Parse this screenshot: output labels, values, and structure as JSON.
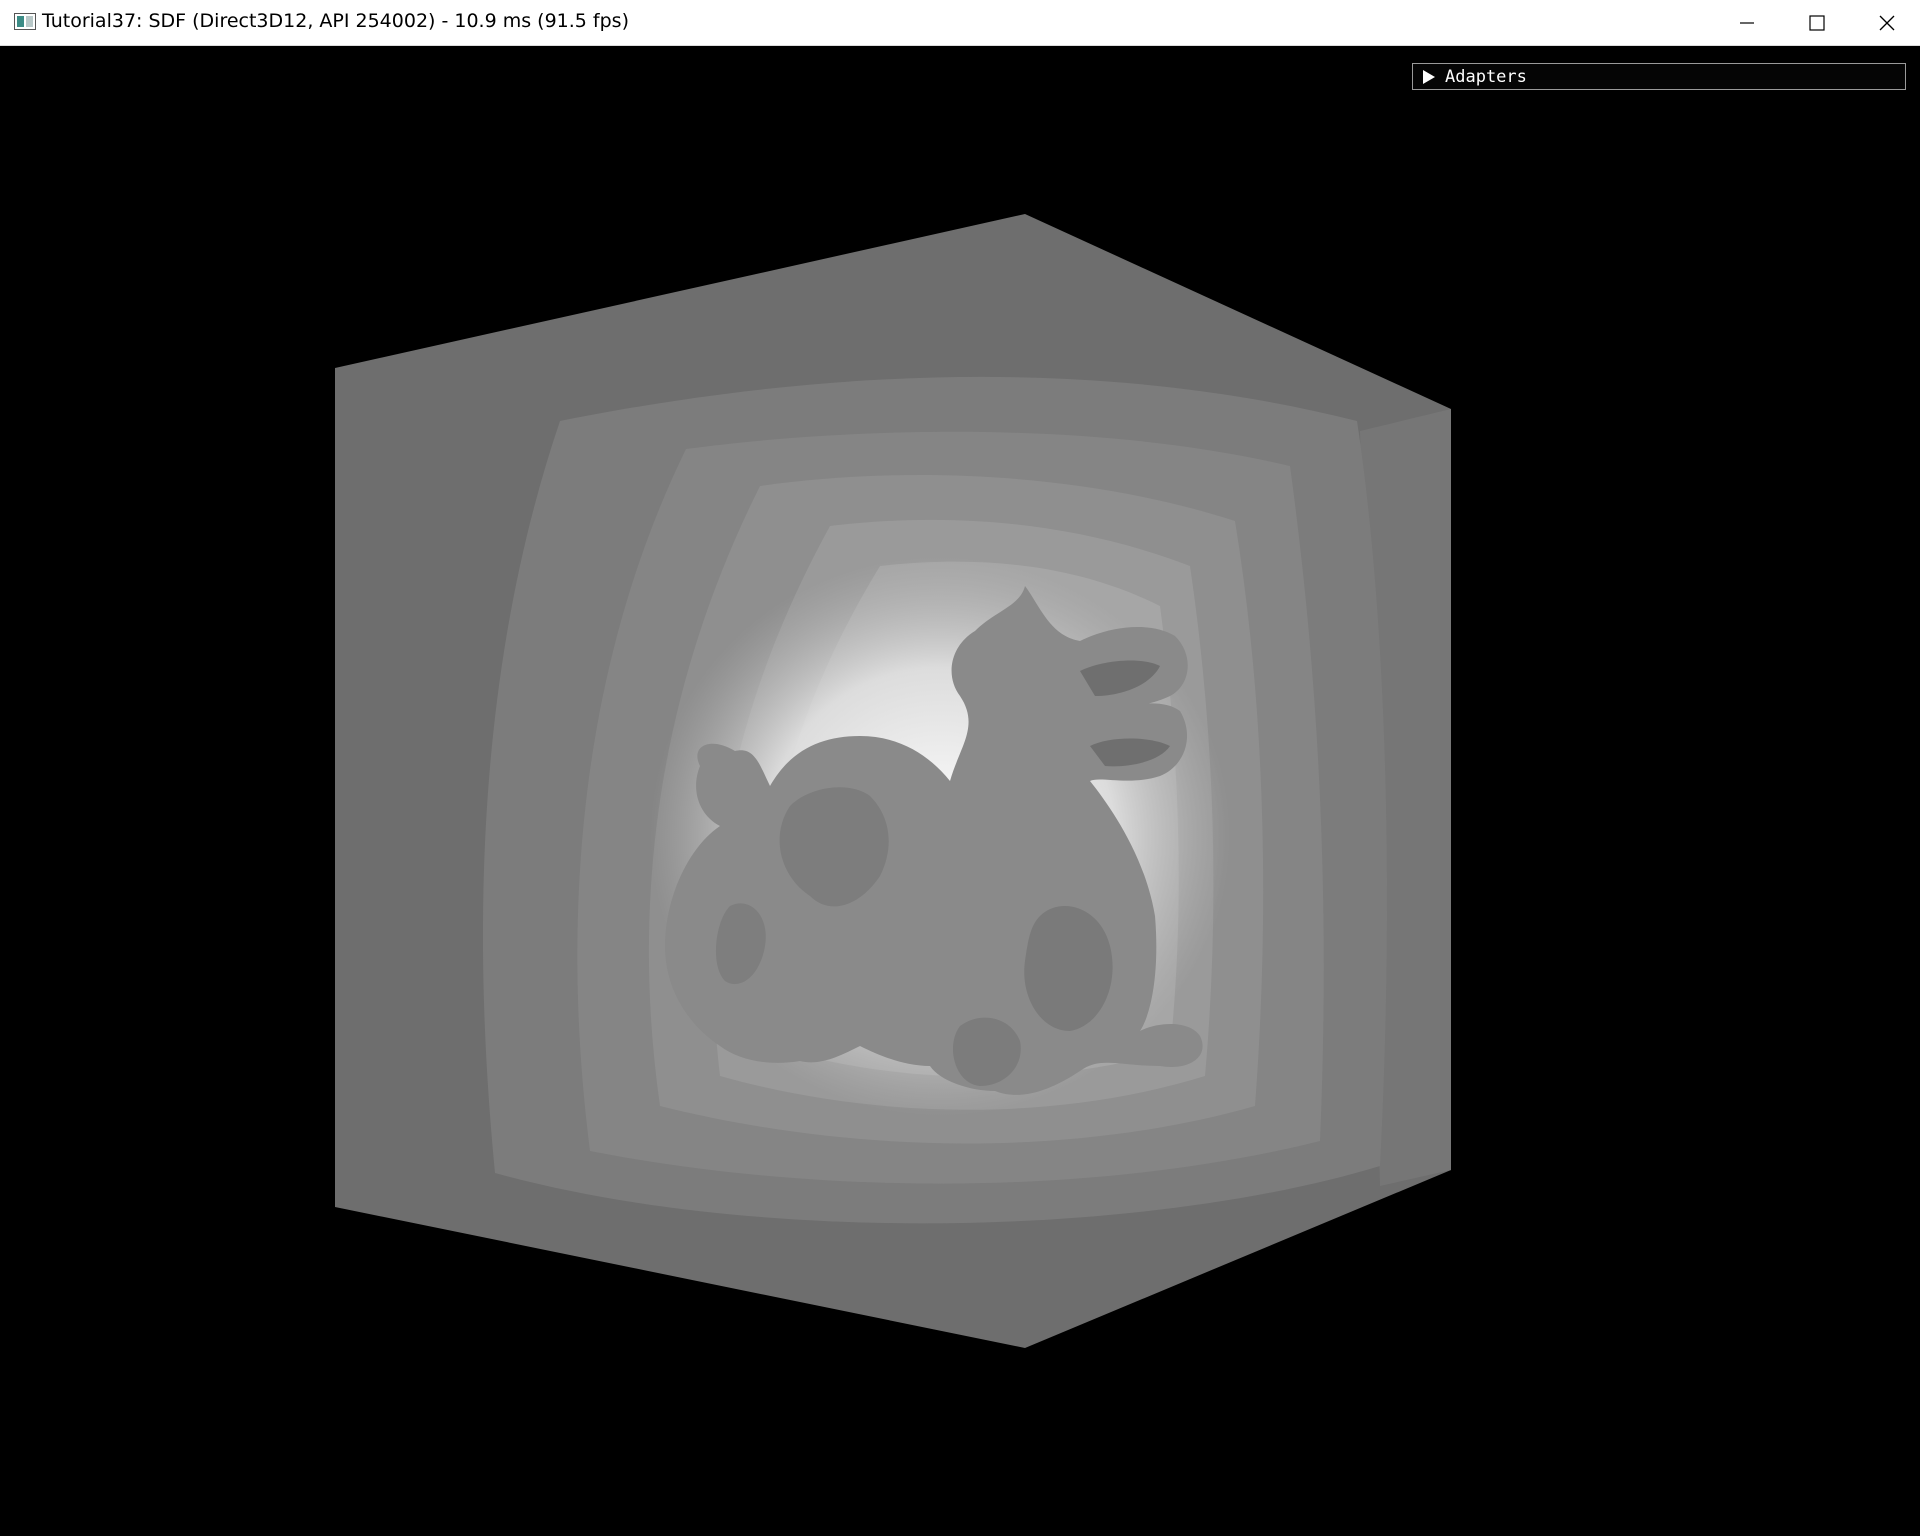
{
  "window": {
    "title": "Tutorial37: SDF (Direct3D12, API 254002) - 10.9 ms (91.5 fps)",
    "controls": {
      "minimize_icon": "minimize-icon",
      "maximize_icon": "maximize-icon",
      "close_icon": "close-icon"
    }
  },
  "overlay": {
    "adapters_label": "Adapters",
    "adapters_expanded": false
  },
  "scene": {
    "description_icon": "sdf-dragon-cube",
    "background_color": "#000000",
    "cube_face_color": "#6e6e6e",
    "cube_side_color": "#7a7a7a",
    "glow_color": "#ffffff"
  }
}
